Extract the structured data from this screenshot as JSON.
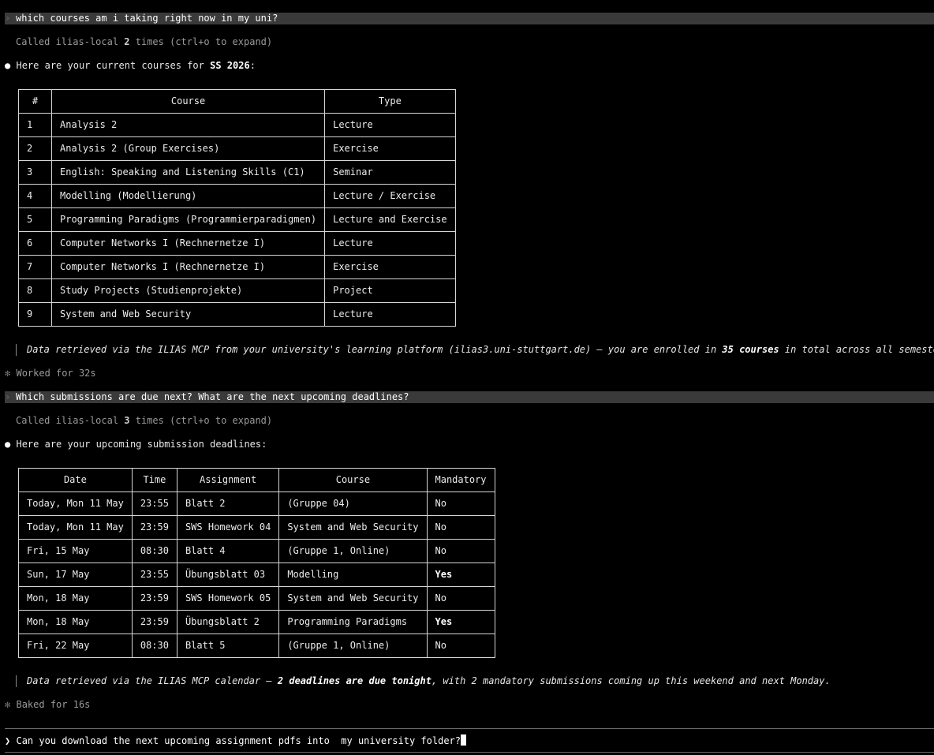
{
  "turn1": {
    "user_prompt": "which courses am i taking right now in my uni?",
    "tool_call": {
      "pre": "Called ilias-local ",
      "count": "2",
      "post": " times (ctrl+o to expand)"
    },
    "intro": {
      "pre": "Here are your current courses for ",
      "term": "SS 2026",
      "post": ":"
    },
    "table": {
      "headers": [
        "#",
        "Course",
        "Type"
      ],
      "rows": [
        [
          "1",
          "Analysis 2",
          "Lecture"
        ],
        [
          "2",
          "Analysis 2 (Group Exercises)",
          "Exercise"
        ],
        [
          "3",
          "English: Speaking and Listening Skills (C1)",
          "Seminar"
        ],
        [
          "4",
          "Modelling (Modellierung)",
          "Lecture / Exercise"
        ],
        [
          "5",
          "Programming Paradigms (Programmierparadigmen)",
          "Lecture and Exercise"
        ],
        [
          "6",
          "Computer Networks I (Rechnernetze I)",
          "Lecture"
        ],
        [
          "7",
          "Computer Networks I (Rechnernetze I)",
          "Exercise"
        ],
        [
          "8",
          "Study Projects (Studienprojekte)",
          "Project"
        ],
        [
          "9",
          "System and Web Security",
          "Lecture"
        ]
      ]
    },
    "note": {
      "pre": "Data retrieved via the ILIAS MCP from your university's learning platform (ilias3.uni-stuttgart.de) — you are enrolled in ",
      "bold": "35 courses",
      "post": " in total across all semesters."
    },
    "status": "Worked for 32s"
  },
  "turn2": {
    "user_prompt": "Which submissions are due next? What are the next upcoming deadlines?",
    "tool_call": {
      "pre": "Called ilias-local ",
      "count": "3",
      "post": " times (ctrl+o to expand)"
    },
    "intro": "Here are your upcoming submission deadlines:",
    "table": {
      "headers": [
        "Date",
        "Time",
        "Assignment",
        "Course",
        "Mandatory"
      ],
      "rows": [
        [
          "Today, Mon 11 May",
          "23:55",
          "Blatt 2",
          "(Gruppe 04)",
          "No"
        ],
        [
          "Today, Mon 11 May",
          "23:59",
          "SWS Homework 04",
          "System and Web Security",
          "No"
        ],
        [
          "Fri, 15 May",
          "08:30",
          "Blatt 4",
          "(Gruppe 1, Online)",
          "No"
        ],
        [
          "Sun, 17 May",
          "23:55",
          "Übungsblatt 03",
          "Modelling",
          "Yes"
        ],
        [
          "Mon, 18 May",
          "23:59",
          "SWS Homework 05",
          "System and Web Security",
          "No"
        ],
        [
          "Mon, 18 May",
          "23:59",
          "Übungsblatt 2",
          "Programming Paradigms",
          "Yes"
        ],
        [
          "Fri, 22 May",
          "08:30",
          "Blatt 5",
          "(Gruppe 1, Online)",
          "No"
        ]
      ]
    },
    "note": {
      "pre": "Data retrieved via the ILIAS MCP calendar — ",
      "bold": "2 deadlines are due tonight",
      "post": ", with 2 mandatory submissions coming up this weekend and next Monday."
    },
    "status": "Baked for 16s"
  },
  "input": {
    "value": "Can you download the next upcoming assignment pdfs into  my university folder?"
  },
  "glyphs": {
    "prompt_chevron": "›",
    "bullet": "●",
    "star": "✻",
    "input_chevron": "❯"
  },
  "colors": {
    "background": "#000000",
    "prompt_bar": "#3a3a3a",
    "dim_text": "#9a9a9a",
    "text": "#e8e8e8"
  }
}
